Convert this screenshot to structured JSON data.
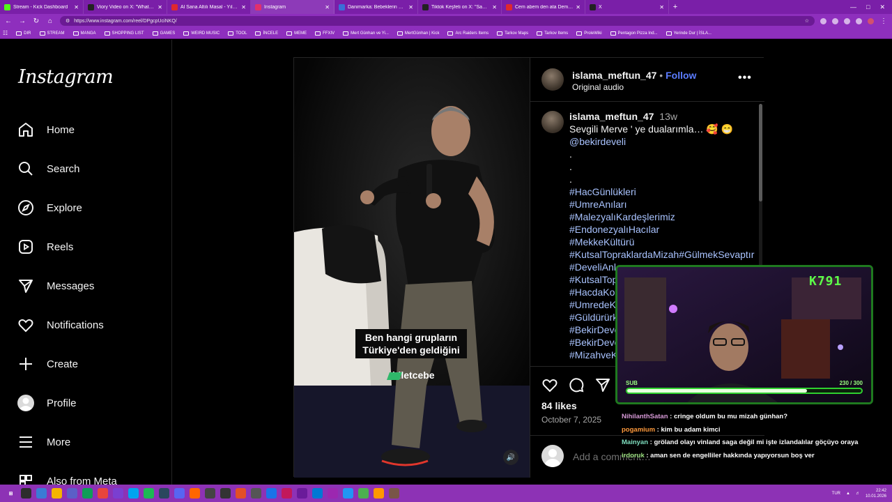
{
  "browser": {
    "tabs": [
      {
        "title": "Stream - Kick Dashboard",
        "color": "#53fc18"
      },
      {
        "title": "Viory Video on X: \"Whatever you",
        "color": "#222222"
      },
      {
        "title": "Al Sana Altılı Masal - Yılmaz Özdil",
        "color": "#e0282e"
      },
      {
        "title": "Instagram",
        "color": "#e1306c",
        "active": true
      },
      {
        "title": "Danimarka: Bebeklerin ailelerinden",
        "color": "#3a6fd8"
      },
      {
        "title": "Tiktok Keşfeti on X: \"Sabah saatle",
        "color": "#222222"
      },
      {
        "title": "Cem abem den ata Demirer takılm",
        "color": "#e0282e"
      },
      {
        "title": "X",
        "color": "#222222"
      }
    ],
    "new_tab": "+",
    "url": "https://www.instagram.com/reel/DPgcpUciNKQ/",
    "bookmarks": [
      "DIR",
      "STREAM",
      "MANGA",
      "SHOPPING LIST",
      "GAMES",
      "WEIRD MUSIC",
      "TOOL",
      "İNCELE",
      "MEME",
      "FFXIV",
      "Mert Günhan ve Yi...",
      "MertGünhan | Kick",
      "Arc Raiders Items",
      "Tarkov Maps",
      "Tarkov Items",
      "ProleWiki",
      "Pentagon Pizza Ind...",
      "Yerinde Dur | İSLA..."
    ]
  },
  "sidebar": {
    "logo": "Instagram",
    "items": [
      {
        "label": "Home",
        "icon": "home-icon"
      },
      {
        "label": "Search",
        "icon": "search-icon"
      },
      {
        "label": "Explore",
        "icon": "explore-icon"
      },
      {
        "label": "Reels",
        "icon": "reels-icon"
      },
      {
        "label": "Messages",
        "icon": "messages-icon"
      },
      {
        "label": "Notifications",
        "icon": "heart-icon"
      },
      {
        "label": "Create",
        "icon": "plus-icon"
      },
      {
        "label": "Profile",
        "icon": "profile-avatar"
      },
      {
        "label": "More",
        "icon": "menu-icon"
      },
      {
        "label": "Also from Meta",
        "icon": "meta-icon"
      }
    ]
  },
  "reel": {
    "subtitle_line1": "Ben hangi grupların",
    "subtitle_line2": "Türkiye'den geldiğini",
    "watermark": "biletcebe",
    "header": {
      "username": "islama_meftun_47",
      "separator": "•",
      "follow": "Follow",
      "audio": "Original audio"
    },
    "caption": {
      "username": "islama_meftun_47",
      "age": "13w",
      "text": "Sevgili Merve ' ye dualarımla… 🥰 😁",
      "mention": "@bekirdeveli",
      "dots": [
        ".",
        ".",
        "."
      ],
      "hashtags": [
        "#HacGünlükleri",
        "#UmreAnıları",
        "#MalezyalıKardeşlerimiz",
        "#EndonezyalıHacılar",
        "#MekkeKültürü",
        "#KutsalTopraklardaMizah#GülmekSevaptır",
        "#DeveliAnl",
        "#KutsalTop",
        "#HacdaKor",
        "#UmredeK",
        "#Güldürürk",
        "#BekirDeve",
        "#BekirDeve",
        "#MizahveK"
      ]
    },
    "likes": "84 likes",
    "date": "October 7, 2025",
    "comment_placeholder": "Add a comment…"
  },
  "stream_overlay": {
    "counter": "K791",
    "sub_label": "SUB",
    "sub_current": "230",
    "sub_separator": "/",
    "sub_goal": "300",
    "sub_progress": 0.7667,
    "chat": [
      {
        "user": "NihilanthSatan",
        "color": "#d89ad8",
        "text": ": cringe oldum bu mu mizah günhan?"
      },
      {
        "user": "pogamium",
        "color": "#ff9a3c",
        "text": ": kim bu adam kimci"
      },
      {
        "user": "Mainyan",
        "color": "#7fe0c0",
        "text": ": gröland olayı vinland saga değil mi işte izlandalılar göçüyo oraya"
      },
      {
        "user": "irdoruk",
        "color": "#9be07f",
        "text": ": aman sen de engelliler hakkında yapıyorsun boş ver"
      }
    ]
  },
  "taskbar": {
    "lang": "TUR",
    "time": "22:42",
    "date": "10.01.2026"
  }
}
